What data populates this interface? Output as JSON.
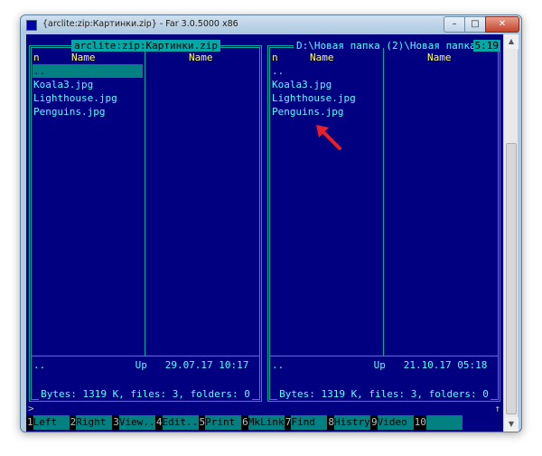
{
  "window": {
    "title": "{arclite:zip:Картинки.zip} - Far 3.0.5000 x86",
    "controls": {
      "minimize": "–",
      "maximize": "□",
      "close": "✕"
    }
  },
  "left_panel": {
    "title": "arclite:zip:Картинки.zip",
    "col_n": "n",
    "col_name_1": "Name",
    "col_name_2": "Name",
    "files": [
      "..",
      "Koala3.jpg",
      "Lighthouse.jpg",
      "Penguins.jpg"
    ],
    "selected_index": 0,
    "status": "..               Up   29.07.17 10:17",
    "summary": "Bytes: 1319 K, files: 3, folders: 0"
  },
  "right_panel": {
    "title": "D:\\Новая папка (2)\\Новая папка",
    "clock": "5:19",
    "col_n": "n",
    "col_name_1": "Name",
    "col_name_2": "Name",
    "files": [
      "..",
      "Koala3.jpg",
      "Lighthouse.jpg",
      "Penguins.jpg"
    ],
    "status": "..               Up   21.10.17 05:18",
    "summary": "Bytes: 1319 K, files: 3, folders: 0"
  },
  "command_line": {
    "prompt": ">",
    "history_arrow": "↑"
  },
  "keybar": [
    {
      "num": "1",
      "label": "Left"
    },
    {
      "num": "2",
      "label": "Right"
    },
    {
      "num": "3",
      "label": "View.."
    },
    {
      "num": "4",
      "label": "Edit.."
    },
    {
      "num": "5",
      "label": "Print"
    },
    {
      "num": "6",
      "label": "MkLink"
    },
    {
      "num": "7",
      "label": "Find"
    },
    {
      "num": "8",
      "label": "Histry"
    },
    {
      "num": "9",
      "label": "Video"
    },
    {
      "num": "10",
      "label": ""
    }
  ],
  "colors": {
    "console_bg": "#000080",
    "panel_border": "#00a8a8",
    "file_text": "#55ffff",
    "header_text": "#ffff55",
    "annotation_arrow": "#e8202a"
  }
}
